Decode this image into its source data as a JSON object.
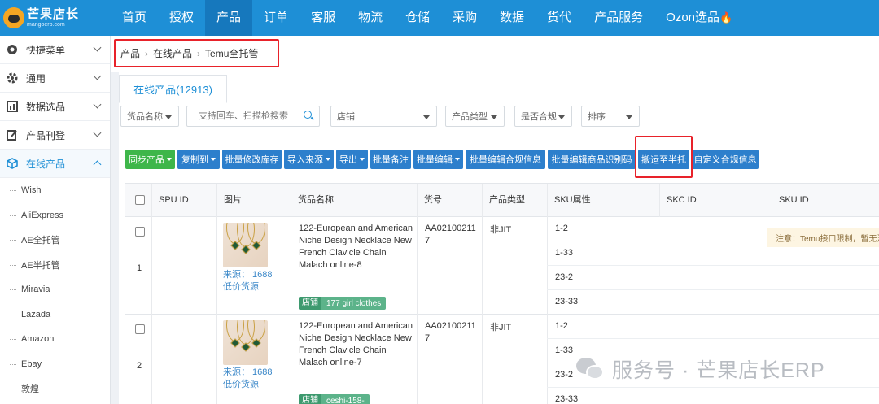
{
  "logo": {
    "title": "芒果店长",
    "subtitle": "mangoerp.com"
  },
  "nav": [
    {
      "label": "首页"
    },
    {
      "label": "授权"
    },
    {
      "label": "产品"
    },
    {
      "label": "订单"
    },
    {
      "label": "客服"
    },
    {
      "label": "物流"
    },
    {
      "label": "仓储"
    },
    {
      "label": "采购"
    },
    {
      "label": "数据"
    },
    {
      "label": "货代"
    },
    {
      "label": "产品服务"
    },
    {
      "label": "Ozon选品"
    }
  ],
  "sidebar": {
    "groups": [
      {
        "label": "快捷菜单",
        "icon": "dashboard-icon"
      },
      {
        "label": "通用",
        "icon": "gear-icon"
      },
      {
        "label": "数据选品",
        "icon": "chart-icon"
      },
      {
        "label": "产品刊登",
        "icon": "edit-icon"
      },
      {
        "label": "在线产品",
        "icon": "cube-icon"
      }
    ],
    "subitems": [
      {
        "label": "Wish"
      },
      {
        "label": "AliExpress"
      },
      {
        "label": "AE全托管"
      },
      {
        "label": "AE半托管"
      },
      {
        "label": "Miravia"
      },
      {
        "label": "Lazada"
      },
      {
        "label": "Amazon"
      },
      {
        "label": "Ebay"
      },
      {
        "label": "敦煌"
      }
    ]
  },
  "breadcrumb": {
    "items": [
      "产品",
      "在线产品",
      "Temu全托管"
    ]
  },
  "tab": {
    "label": "在线产品(12913)"
  },
  "filters": {
    "field_select": "货品名称",
    "search_placeholder": "支持回车、扫描枪搜索",
    "store_select": "店铺",
    "type_select": "产品类型",
    "compliance_select": "是否合规",
    "sort_select": "排序"
  },
  "toolbar": {
    "sync": "同步产品",
    "copy": "复制到",
    "batch_stock": "批量修改库存",
    "import": "导入来源",
    "export": "导出",
    "batch_note": "批量备注",
    "batch_edit": "批量编辑",
    "batch_compliance": "批量编辑合规信息",
    "batch_code": "批量编辑商品识别码",
    "move_half": "搬运至半托",
    "custom_compliance": "自定义合规信息",
    "notice": "注意：Temu接口限制，暂无法"
  },
  "table": {
    "headers": [
      "SPU ID",
      "图片",
      "货品名称",
      "货号",
      "产品类型",
      "SKU属性",
      "SKC ID",
      "SKU ID"
    ],
    "rows": [
      {
        "num": "1",
        "source": "来源： 1688",
        "source2": "低价货源",
        "name": "122-European and American Niche Design Necklace New French Clavicle Chain Malach online-8",
        "store_key": "店铺",
        "store_val": "177 girl clothes",
        "sku_no": "AA021002117",
        "type": "非JIT",
        "skus": [
          "1-2",
          "1-33",
          "23-2",
          "23-33"
        ]
      },
      {
        "num": "2",
        "source": "来源： 1688",
        "source2": "低价货源",
        "name": "122-European and American Niche Design Necklace New French Clavicle Chain Malach online-7",
        "store_key": "店铺",
        "store_val": "ceshi-158-",
        "sku_no": "AA021002117",
        "type": "非JIT",
        "skus": [
          "1-2",
          "1-33",
          "23-2",
          "23-33"
        ]
      }
    ]
  },
  "watermark": {
    "text": "服务号 · 芒果店长ERP"
  }
}
